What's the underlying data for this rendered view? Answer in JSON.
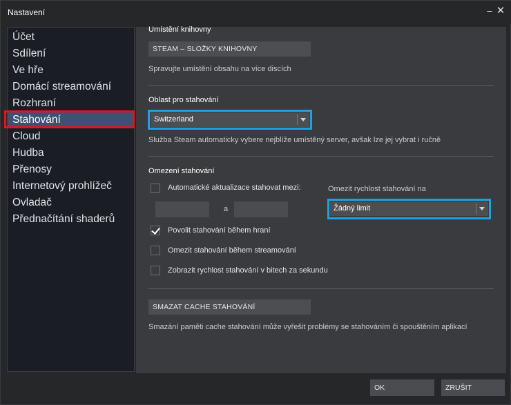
{
  "window": {
    "title": "Nastavení",
    "minimize_glyph": "–",
    "close_glyph": "✕"
  },
  "sidebar": {
    "items": [
      {
        "label": "Účet"
      },
      {
        "label": "Sdílení"
      },
      {
        "label": "Ve hře"
      },
      {
        "label": "Domácí streamování"
      },
      {
        "label": "Rozhraní"
      },
      {
        "label": "Stahování",
        "active": true
      },
      {
        "label": "Cloud"
      },
      {
        "label": "Hudba"
      },
      {
        "label": "Přenosy"
      },
      {
        "label": "Internetový prohlížeč"
      },
      {
        "label": "Ovladač"
      },
      {
        "label": "Přednačítání shaderů"
      }
    ]
  },
  "library": {
    "title": "Umístění knihovny",
    "button_label": "STEAM – SLOŽKY KNIHOVNY",
    "description": "Spravujte umístění obsahu na více discích"
  },
  "region": {
    "title": "Oblast pro stahování",
    "selected": "Switzerland",
    "description": "Služba Steam automaticky vybere nejblíže umístěný server, avšak lze jej vybrat i ručně"
  },
  "limits": {
    "title": "Omezení stahování",
    "auto_update_label": "Automatické aktualizace stahovat mezi:",
    "auto_update_checked": false,
    "between_label": "a",
    "from_value": "",
    "to_value": "",
    "speed_limit_title": "Omezit rychlost stahování na",
    "speed_limit_selected": "Žádný limit",
    "allow_ingame_label": "Povolit stahování během hraní",
    "allow_ingame_checked": true,
    "limit_streaming_label": "Omezit stahování během streamování",
    "limit_streaming_checked": false,
    "bits_label": "Zobrazit rychlost stahování v bitech za sekundu",
    "bits_checked": false
  },
  "cache": {
    "button_label": "SMAZAT CACHE STAHOVÁNÍ",
    "description": "Smazání paměti cache stahování může vyřešit problémy se stahováním či spouštěním aplikací"
  },
  "footer": {
    "ok_label": "OK",
    "cancel_label": "ZRUŠIT"
  },
  "colors": {
    "highlight_red": "#e0161d",
    "highlight_blue": "#1ca2e3",
    "active_item": "#3f5070"
  }
}
